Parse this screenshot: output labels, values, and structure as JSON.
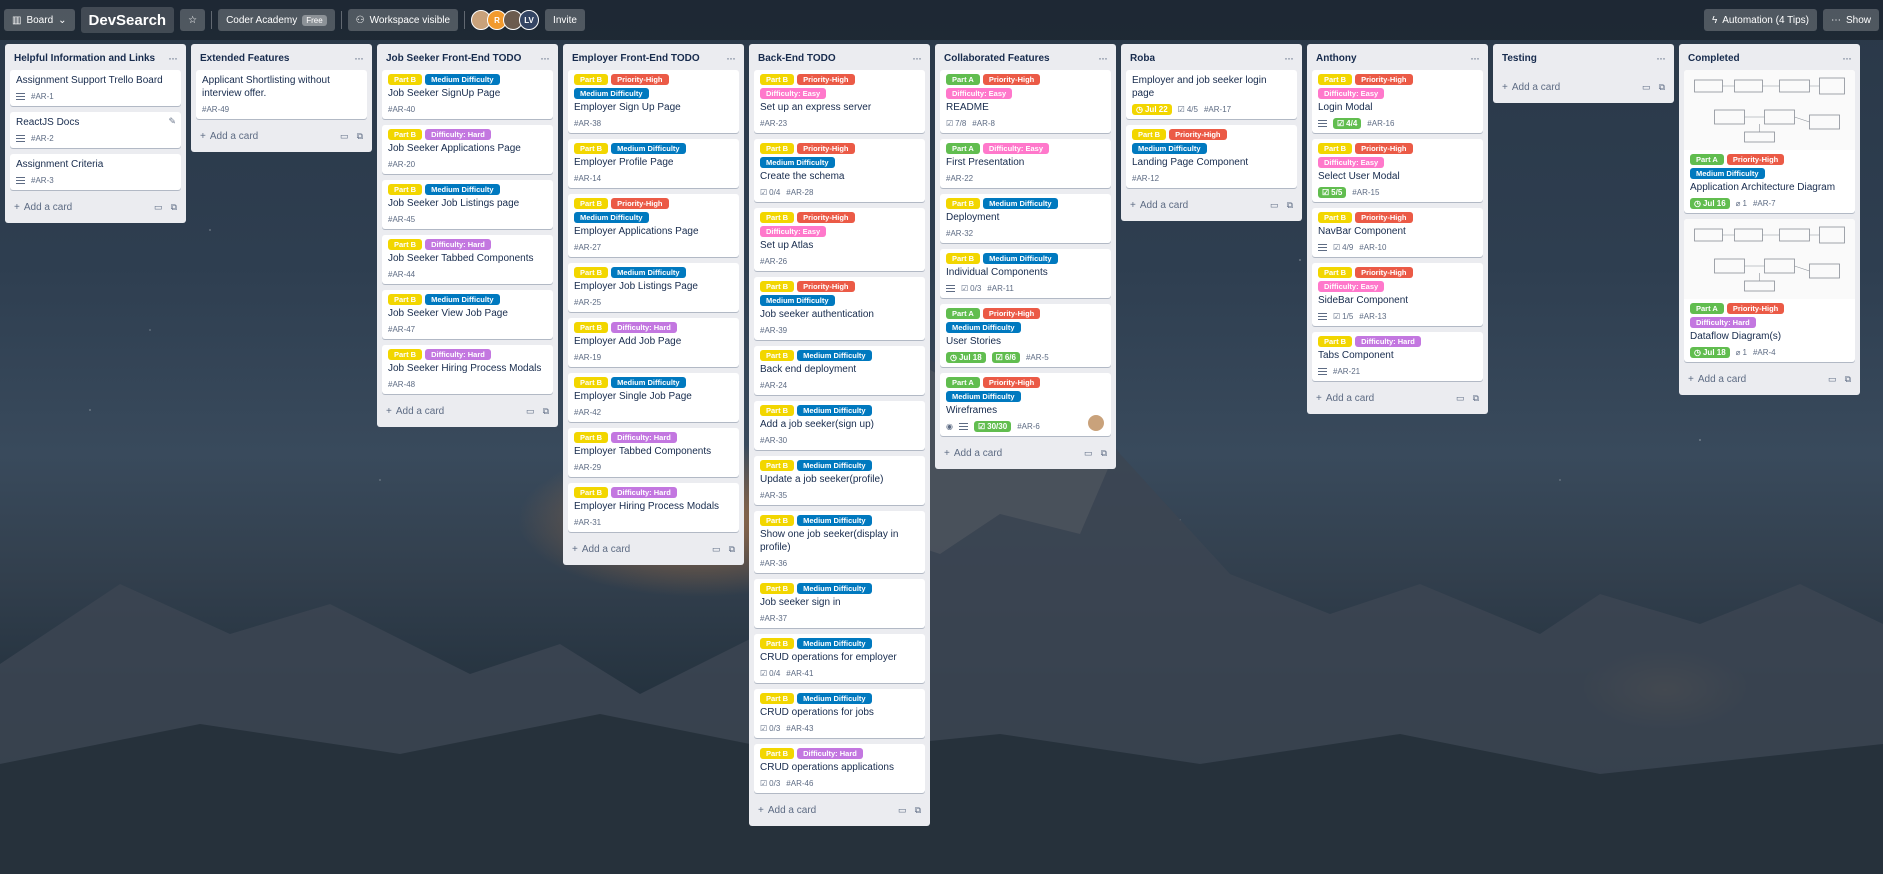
{
  "colors": {
    "part_a": "#61bd4f",
    "part_b": "#f2d600",
    "priority_high": "#eb5a46",
    "difficulty_medium": "#0079bf",
    "difficulty_easy": "#ff78cb",
    "difficulty_hard": "#c377e0",
    "due_green": "#61bd4f",
    "due_yellow": "#f2d600",
    "check_done": "#61bd4f"
  },
  "topbar": {
    "view_label": "Board",
    "board_title": "DevSearch",
    "workspace": "Coder Academy",
    "workspace_badge": "Free",
    "visibility": "Workspace visible",
    "member_initials": [
      "",
      "R",
      "",
      "LV"
    ],
    "invite": "Invite",
    "automation": "Automation (4 Tips)",
    "show_menu": "Show"
  },
  "lists": [
    {
      "title": "Helpful Information and Links",
      "cards": [
        {
          "title": "Assignment Support Trello Board",
          "id": "#AR-1",
          "desc": true
        },
        {
          "title": "ReactJS Docs",
          "id": "#AR-2",
          "desc": true,
          "edit": true
        },
        {
          "title": "Assignment Criteria",
          "id": "#AR-3",
          "desc": true
        }
      ],
      "add": "Add a card"
    },
    {
      "title": "Extended Features",
      "cards": [
        {
          "title": "Applicant Shortlisting without interview offer.",
          "id": "#AR-49"
        }
      ],
      "add": "Add a card"
    },
    {
      "title": "Job Seeker Front-End TODO",
      "cards": [
        {
          "labels": [
            "Part B",
            "Medium Difficulty"
          ],
          "title": "Job Seeker SignUp Page",
          "id": "#AR-40"
        },
        {
          "labels": [
            "Part B",
            "Difficulty: Hard"
          ],
          "title": "Job Seeker Applications Page",
          "id": "#AR-20"
        },
        {
          "labels": [
            "Part B",
            "Medium Difficulty"
          ],
          "title": "Job Seeker Job Listings page",
          "id": "#AR-45"
        },
        {
          "labels": [
            "Part B",
            "Difficulty: Hard"
          ],
          "title": "Job Seeker Tabbed Components",
          "id": "#AR-44"
        },
        {
          "labels": [
            "Part B",
            "Medium Difficulty"
          ],
          "title": "Job Seeker View Job Page",
          "id": "#AR-47"
        },
        {
          "labels": [
            "Part B",
            "Difficulty: Hard"
          ],
          "title": "Job Seeker Hiring Process Modals",
          "id": "#AR-48"
        }
      ],
      "add": "Add a card"
    },
    {
      "title": "Employer Front-End TODO",
      "cards": [
        {
          "labels": [
            "Part B",
            "Priority-High",
            "Medium Difficulty"
          ],
          "title": "Employer Sign Up Page",
          "id": "#AR-38"
        },
        {
          "labels": [
            "Part B",
            "Medium Difficulty"
          ],
          "title": "Employer Profile Page",
          "id": "#AR-14"
        },
        {
          "labels": [
            "Part B",
            "Priority-High",
            "Medium Difficulty"
          ],
          "title": "Employer Applications Page",
          "id": "#AR-27"
        },
        {
          "labels": [
            "Part B",
            "Medium Difficulty"
          ],
          "title": "Employer Job Listings Page",
          "id": "#AR-25"
        },
        {
          "labels": [
            "Part B",
            "Difficulty: Hard"
          ],
          "title": "Employer Add Job Page",
          "id": "#AR-19"
        },
        {
          "labels": [
            "Part B",
            "Medium Difficulty"
          ],
          "title": "Employer Single Job Page",
          "id": "#AR-42"
        },
        {
          "labels": [
            "Part B",
            "Difficulty: Hard"
          ],
          "title": "Employer Tabbed Components",
          "id": "#AR-29"
        },
        {
          "labels": [
            "Part B",
            "Difficulty: Hard"
          ],
          "title": "Employer Hiring Process Modals",
          "id": "#AR-31"
        }
      ],
      "add": "Add a card"
    },
    {
      "title": "Back-End TODO",
      "cards": [
        {
          "labels": [
            "Part B",
            "Priority-High",
            "Difficulty: Easy"
          ],
          "title": "Set up an express server",
          "id": "#AR-23"
        },
        {
          "labels": [
            "Part B",
            "Priority-High",
            "Medium Difficulty"
          ],
          "title": "Create the schema",
          "checklist": "0/4",
          "id": "#AR-28"
        },
        {
          "labels": [
            "Part B",
            "Priority-High",
            "Difficulty: Easy"
          ],
          "title": "Set up Atlas",
          "id": "#AR-26"
        },
        {
          "labels": [
            "Part B",
            "Priority-High",
            "Medium Difficulty"
          ],
          "title": "Job seeker authentication",
          "id": "#AR-39"
        },
        {
          "labels": [
            "Part B",
            "Medium Difficulty"
          ],
          "title": "Back end deployment",
          "id": "#AR-24"
        },
        {
          "labels": [
            "Part B",
            "Medium Difficulty"
          ],
          "title": "Add a job seeker(sign up)",
          "id": "#AR-30"
        },
        {
          "labels": [
            "Part B",
            "Medium Difficulty"
          ],
          "title": "Update a job seeker(profile)",
          "id": "#AR-35"
        },
        {
          "labels": [
            "Part B",
            "Medium Difficulty"
          ],
          "title": "Show one job seeker(display in profile)",
          "id": "#AR-36"
        },
        {
          "labels": [
            "Part B",
            "Medium Difficulty"
          ],
          "title": "Job seeker sign in",
          "id": "#AR-37"
        },
        {
          "labels": [
            "Part B",
            "Medium Difficulty"
          ],
          "title": "CRUD operations for employer",
          "checklist": "0/4",
          "id": "#AR-41"
        },
        {
          "labels": [
            "Part B",
            "Medium Difficulty"
          ],
          "title": "CRUD operations for jobs",
          "checklist": "0/3",
          "id": "#AR-43"
        },
        {
          "labels": [
            "Part B",
            "Difficulty: Hard"
          ],
          "title": "CRUD operations applications",
          "checklist": "0/3",
          "id": "#AR-46"
        }
      ],
      "add": "Add a card"
    },
    {
      "title": "Collaborated Features",
      "cards": [
        {
          "labels": [
            "Part A",
            "Priority-High",
            "Difficulty: Easy"
          ],
          "title": "README",
          "checklist": "7/8",
          "id": "#AR-8"
        },
        {
          "labels": [
            "Part A",
            "Difficulty: Easy"
          ],
          "title": "First Presentation",
          "id": "#AR-22"
        },
        {
          "labels": [
            "Part B",
            "Medium Difficulty"
          ],
          "title": "Deployment",
          "id": "#AR-32"
        },
        {
          "labels": [
            "Part B",
            "Medium Difficulty"
          ],
          "title": "Individual Components",
          "desc": true,
          "checklist": "0/3",
          "id": "#AR-11"
        },
        {
          "labels": [
            "Part A",
            "Priority-High",
            "Medium Difficulty"
          ],
          "title": "User Stories",
          "due": "Jul 18",
          "due_color": "green",
          "checklist": "6/6",
          "checklist_done": true,
          "id": "#AR-5"
        },
        {
          "labels": [
            "Part A",
            "Priority-High",
            "Medium Difficulty"
          ],
          "title": "Wireframes",
          "watch": true,
          "desc": true,
          "checklist": "30/30",
          "checklist_done": true,
          "id": "#AR-6",
          "avatar": true
        }
      ],
      "add": "Add a card"
    },
    {
      "title": "Roba",
      "cards": [
        {
          "title": "Employer and job seeker login page",
          "due": "Jul 22",
          "due_color": "yellow",
          "checklist": "4/5",
          "id": "#AR-17"
        },
        {
          "labels": [
            "Part B",
            "Priority-High",
            "Medium Difficulty"
          ],
          "title": "Landing Page Component",
          "id": "#AR-12"
        }
      ],
      "add": "Add a card"
    },
    {
      "title": "Anthony",
      "cards": [
        {
          "labels": [
            "Part B",
            "Priority-High",
            "Difficulty: Easy"
          ],
          "title": "Login Modal",
          "desc": true,
          "checklist": "4/4",
          "checklist_done": true,
          "id": "#AR-16"
        },
        {
          "labels": [
            "Part B",
            "Priority-High",
            "Difficulty: Easy"
          ],
          "title": "Select User Modal",
          "checklist": "5/5",
          "checklist_done": true,
          "id": "#AR-15"
        },
        {
          "labels": [
            "Part B",
            "Priority-High"
          ],
          "title": "NavBar Component",
          "desc": true,
          "checklist": "4/9",
          "id": "#AR-10"
        },
        {
          "labels": [
            "Part B",
            "Priority-High",
            "Difficulty: Easy"
          ],
          "title": "SideBar Component",
          "desc": true,
          "checklist": "1/5",
          "id": "#AR-13"
        },
        {
          "labels": [
            "Part B",
            "Difficulty: Hard"
          ],
          "title": "Tabs Component",
          "desc": true,
          "id": "#AR-21"
        }
      ],
      "add": "Add a card"
    },
    {
      "title": "Testing",
      "cards": [],
      "add": "Add a card"
    },
    {
      "title": "Completed",
      "cards": [
        {
          "cover": true,
          "labels": [
            "Part A",
            "Priority-High",
            "Medium Difficulty"
          ],
          "title": "Application Architecture Diagram",
          "due": "Jul 16",
          "due_color": "green",
          "attachments": "1",
          "id": "#AR-7"
        },
        {
          "cover": true,
          "labels": [
            "Part A",
            "Priority-High",
            "Difficulty: Hard"
          ],
          "title": "Dataflow Diagram(s)",
          "due": "Jul 18",
          "due_color": "green",
          "attachments": "1",
          "id": "#AR-4"
        }
      ],
      "add": "Add a card"
    }
  ]
}
